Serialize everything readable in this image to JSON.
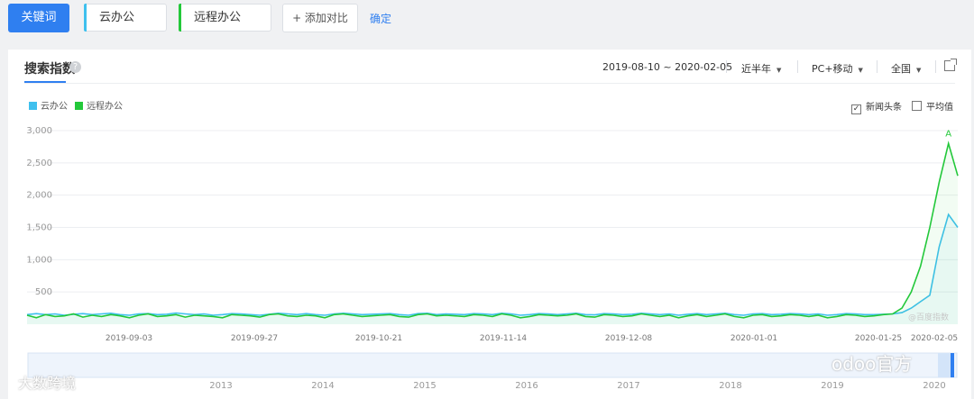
{
  "toolbar": {
    "keyword_button": "关键词",
    "keyword1": "云办公",
    "keyword2": "远程办公",
    "add_compare": "+ 添加对比",
    "confirm": "确定"
  },
  "panel": {
    "title": "搜索指数",
    "help_glyph": "?",
    "date_range": "2019-08-10 ~ 2020-02-05",
    "period": "近半年",
    "device": "PC+移动",
    "region": "全国"
  },
  "legend": {
    "series1": "云办公",
    "series2": "远程办公",
    "news_headlines": "新闻头条",
    "average": "平均值",
    "news_checked": true,
    "average_checked": false
  },
  "colors": {
    "accent": "#2f7ff0",
    "series1": "#3fc0ee",
    "series2": "#23c83a"
  },
  "watermarks": {
    "left": "大数跨境",
    "right": "odoo官方",
    "baidu": "@百度指数"
  },
  "chart_data": {
    "type": "line",
    "y_ticks": [
      "3,000",
      "2,500",
      "2,000",
      "1,500",
      "1,000",
      "500"
    ],
    "ylim": [
      0,
      3000
    ],
    "x_labels": [
      "2019-09-03",
      "2019-09-27",
      "2019-10-21",
      "2019-11-14",
      "2019-12-08",
      "2020-01-01",
      "2020-01-25",
      "2020-02-05"
    ],
    "annotation": "A",
    "series": [
      {
        "name": "云办公",
        "values": [
          150,
          165,
          150,
          160,
          140,
          155,
          165,
          150,
          160,
          170,
          150,
          140,
          160,
          165,
          150,
          155,
          175,
          160,
          150,
          160,
          140,
          150,
          165,
          160,
          150,
          140,
          155,
          170,
          160,
          150,
          165,
          150,
          140,
          160,
          170,
          160,
          150,
          155,
          160,
          165,
          150,
          140,
          165,
          170,
          150,
          160,
          155,
          150,
          165,
          160,
          150,
          170,
          160,
          140,
          150,
          165,
          160,
          150,
          160,
          170,
          150,
          145,
          165,
          160,
          150,
          155,
          170,
          160,
          150,
          160,
          140,
          155,
          165,
          150,
          160,
          170,
          150,
          140,
          160,
          165,
          150,
          155,
          165,
          160,
          150,
          160,
          140,
          150,
          165,
          160,
          150,
          150,
          155,
          160,
          180,
          250,
          350,
          450,
          1200,
          1700,
          1500
        ]
      },
      {
        "name": "远程办公",
        "values": [
          140,
          100,
          150,
          120,
          130,
          160,
          110,
          140,
          120,
          150,
          130,
          100,
          140,
          160,
          120,
          130,
          150,
          110,
          140,
          130,
          120,
          100,
          150,
          140,
          130,
          110,
          150,
          160,
          130,
          120,
          140,
          130,
          100,
          150,
          160,
          140,
          120,
          130,
          140,
          150,
          120,
          110,
          150,
          160,
          130,
          140,
          130,
          120,
          150,
          140,
          120,
          160,
          140,
          100,
          120,
          150,
          140,
          130,
          140,
          160,
          120,
          110,
          150,
          140,
          120,
          130,
          160,
          140,
          120,
          140,
          100,
          130,
          150,
          120,
          140,
          160,
          120,
          100,
          140,
          150,
          120,
          130,
          150,
          140,
          120,
          140,
          100,
          120,
          150,
          140,
          120,
          130,
          150,
          160,
          250,
          500,
          900,
          1500,
          2200,
          2800,
          2300
        ]
      }
    ],
    "range_years": [
      "2013",
      "2014",
      "2015",
      "2016",
      "2017",
      "2018",
      "2019",
      "2020"
    ]
  }
}
